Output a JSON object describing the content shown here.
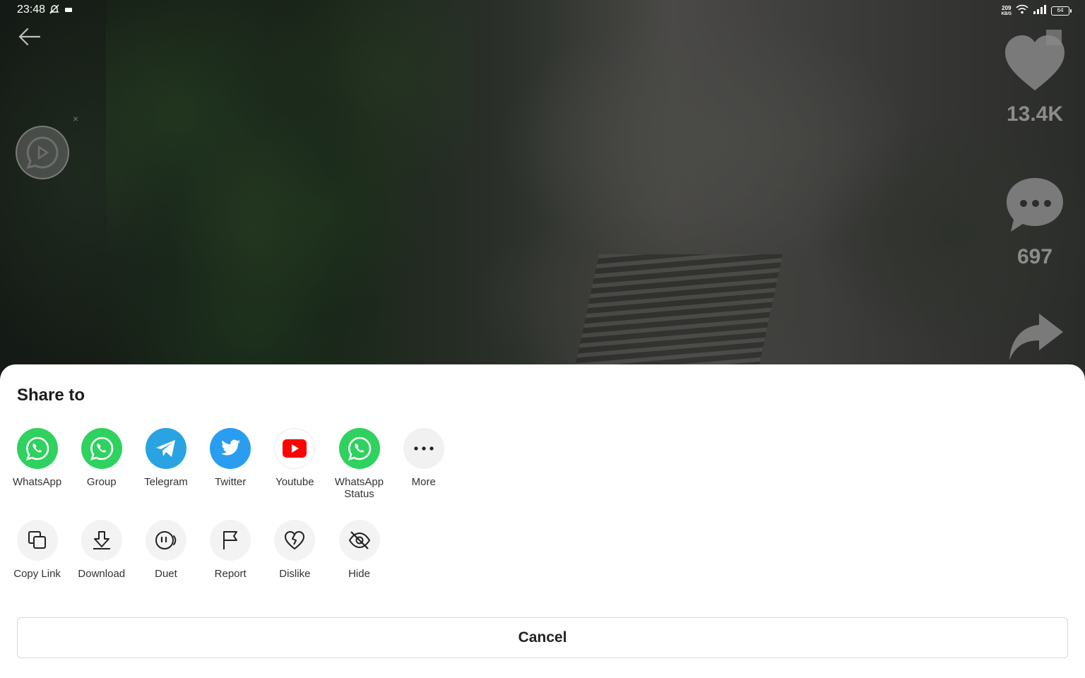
{
  "status_bar": {
    "time": "23:48",
    "net_speed_value": "209",
    "net_speed_unit": "KB/S",
    "battery": "64"
  },
  "video": {
    "like_count": "13.4K",
    "comment_count": "697"
  },
  "share_sheet": {
    "title": "Share to",
    "share_targets": [
      {
        "label": "WhatsApp",
        "icon": "whatsapp-icon"
      },
      {
        "label": "Group",
        "icon": "whatsapp-icon"
      },
      {
        "label": "Telegram",
        "icon": "telegram-icon"
      },
      {
        "label": "Twitter",
        "icon": "twitter-icon"
      },
      {
        "label": "Youtube",
        "icon": "youtube-icon"
      },
      {
        "label": "WhatsApp Status",
        "icon": "whatsapp-icon"
      },
      {
        "label": "More",
        "icon": "more-icon"
      }
    ],
    "actions": [
      {
        "label": "Copy Link",
        "icon": "copy-link-icon"
      },
      {
        "label": "Download",
        "icon": "download-icon"
      },
      {
        "label": "Duet",
        "icon": "duet-icon"
      },
      {
        "label": "Report",
        "icon": "flag-icon"
      },
      {
        "label": "Dislike",
        "icon": "broken-heart-icon"
      },
      {
        "label": "Hide",
        "icon": "eye-off-icon"
      }
    ],
    "cancel_label": "Cancel"
  },
  "colors": {
    "whatsapp": "#2fd15f",
    "telegram": "#2aa3e3",
    "twitter": "#2a9df0",
    "youtube": "#ff0000"
  }
}
